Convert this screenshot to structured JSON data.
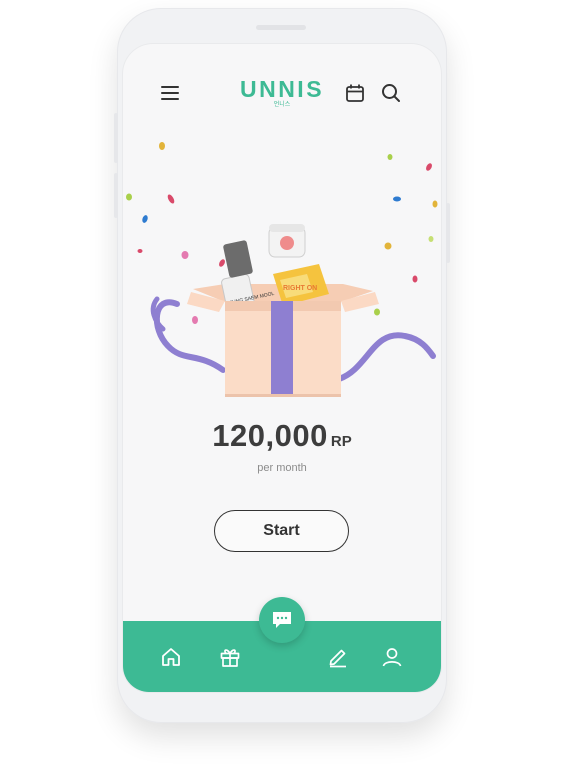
{
  "app": {
    "logo_text": "UNNIS",
    "logo_subtext": "언니스"
  },
  "header": {
    "icons": [
      "menu-icon",
      "calendar-icon",
      "search-icon"
    ]
  },
  "main": {
    "price_value": "120,000",
    "price_currency": "RP",
    "price_period": "per month",
    "start_label": "Start",
    "illustration_labels": {
      "product_brand": "JUNG SAEM MOOL",
      "box_text": "RIGHT ON"
    }
  },
  "bottom_nav": {
    "items": [
      "home-icon",
      "gift-icon",
      "edit-icon",
      "user-icon"
    ],
    "chat_icon": "chat-icon"
  },
  "colors": {
    "accent": "#3dba94",
    "ribbon": "#8e7fd1",
    "box": "#fbd9c4"
  }
}
